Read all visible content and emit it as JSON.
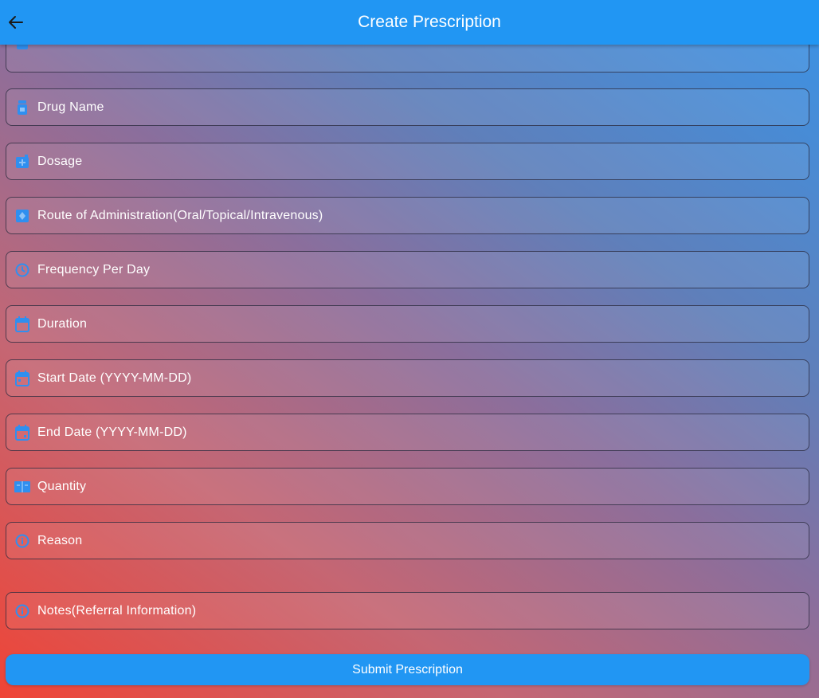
{
  "appbar": {
    "title": "Create Prescription"
  },
  "form": {
    "fields": [
      {
        "label": "",
        "icon": "medical-icon"
      },
      {
        "label": "Drug Name",
        "icon": "pill-bottle-icon"
      },
      {
        "label": "Dosage",
        "icon": "dosage-icon"
      },
      {
        "label": "Route of Administration(Oral/Topical/Intravenous)",
        "icon": "route-icon"
      },
      {
        "label": "Frequency Per Day",
        "icon": "clock-icon"
      },
      {
        "label": "Duration",
        "icon": "calendar-icon"
      },
      {
        "label": "Start Date (YYYY-MM-DD)",
        "icon": "calendar-icon"
      },
      {
        "label": "End Date (YYYY-MM-DD)",
        "icon": "calendar-icon"
      },
      {
        "label": "Quantity",
        "icon": "quantity-icon"
      },
      {
        "label": "Reason",
        "icon": "info-icon"
      },
      {
        "label": "Notes(Referral Information)",
        "icon": "info-icon"
      }
    ],
    "submit_label": "Submit Prescription"
  },
  "colors": {
    "primary": "#2196f3",
    "text": "#ffffff",
    "gradient_start": "#ef4436",
    "gradient_end": "#3a93e6"
  }
}
